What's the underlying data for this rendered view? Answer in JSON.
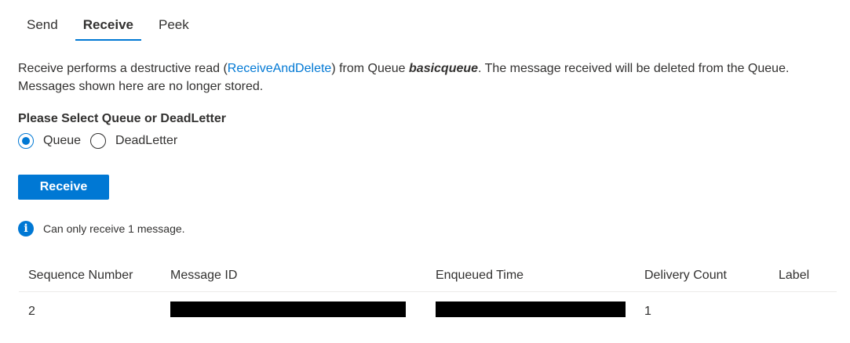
{
  "tabs": [
    "Send",
    "Receive",
    "Peek"
  ],
  "description": {
    "part1": "Receive performs a destructive read (",
    "link": "ReceiveAndDelete",
    "part2": ") from Queue ",
    "queue": "basicqueue",
    "part3": ". The message received will be deleted from the Queue. Messages shown here are no longer stored."
  },
  "select_label": "Please Select Queue or DeadLetter",
  "radios": [
    "Queue",
    "DeadLetter"
  ],
  "receive_button": "Receive",
  "info": "Can only receive 1 message.",
  "table": {
    "headers": [
      "Sequence Number",
      "Message ID",
      "Enqueued Time",
      "Delivery Count",
      "Label"
    ],
    "rows": [
      {
        "seq": "2",
        "delivery": "1"
      }
    ]
  }
}
